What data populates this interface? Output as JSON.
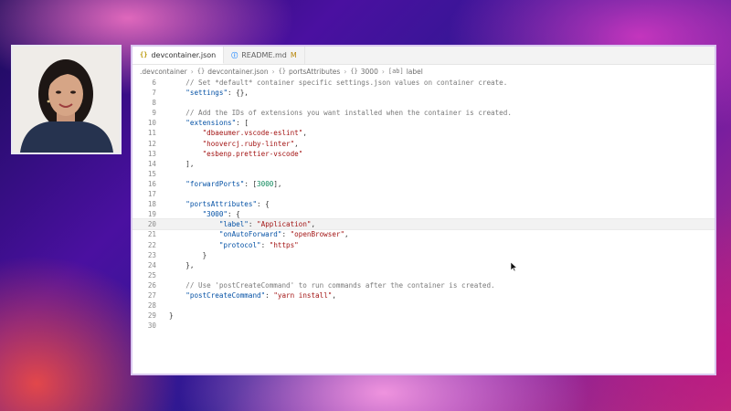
{
  "tabs": [
    {
      "label": "devcontainer.json",
      "icon": "json-braces-icon",
      "active": true,
      "modified": ""
    },
    {
      "label": "README.md",
      "icon": "info-icon",
      "active": false,
      "modified": "M"
    }
  ],
  "breadcrumb": {
    "items": [
      ".devcontainer",
      "devcontainer.json",
      "portsAttributes",
      "3000",
      "label"
    ],
    "icons": [
      "",
      "{}",
      "{}",
      "{}",
      "[ab]"
    ]
  },
  "code_lines": [
    {
      "n": "6",
      "text": "    // Set *default* container specific settings.json values on container create."
    },
    {
      "n": "7",
      "text": "    \"settings\": {},"
    },
    {
      "n": "8",
      "text": ""
    },
    {
      "n": "9",
      "text": "    // Add the IDs of extensions you want installed when the container is created."
    },
    {
      "n": "10",
      "text": "    \"extensions\": ["
    },
    {
      "n": "11",
      "text": "        \"dbaeumer.vscode-eslint\","
    },
    {
      "n": "12",
      "text": "        \"hoovercj.ruby-linter\","
    },
    {
      "n": "13",
      "text": "        \"esbenp.prettier-vscode\""
    },
    {
      "n": "14",
      "text": "    ],"
    },
    {
      "n": "15",
      "text": ""
    },
    {
      "n": "16",
      "text": "    \"forwardPorts\": [3000],"
    },
    {
      "n": "17",
      "text": ""
    },
    {
      "n": "18",
      "text": "    \"portsAttributes\": {"
    },
    {
      "n": "19",
      "text": "        \"3000\": {"
    },
    {
      "n": "20",
      "text": "            \"label\": \"Application\","
    },
    {
      "n": "21",
      "text": "            \"onAutoForward\": \"openBrowser\","
    },
    {
      "n": "22",
      "text": "            \"protocol\": \"https\""
    },
    {
      "n": "23",
      "text": "        }"
    },
    {
      "n": "24",
      "text": "    },"
    },
    {
      "n": "25",
      "text": ""
    },
    {
      "n": "26",
      "text": "    // Use 'postCreateCommand' to run commands after the container is created."
    },
    {
      "n": "27",
      "text": "    \"postCreateCommand\": \"yarn install\","
    },
    {
      "n": "28",
      "text": ""
    },
    {
      "n": "29",
      "text": "}"
    },
    {
      "n": "30",
      "text": ""
    }
  ],
  "current_line": "20",
  "colors": {
    "key": "#0451a5",
    "string": "#a31515",
    "number": "#098658",
    "comment": "#7a7a7a",
    "accent_border": "#d9c7f0"
  }
}
